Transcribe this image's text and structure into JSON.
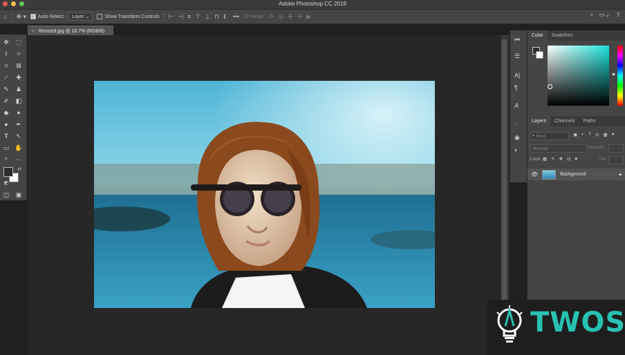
{
  "window": {
    "title": "Adobe Photoshop CC 2019"
  },
  "options_bar": {
    "auto_select_label": "Auto-Select:",
    "auto_select_checked": true,
    "layer_select_value": "Layer",
    "show_transform_label": "Show Transform Controls",
    "mode_3d_label": "3D Mode:"
  },
  "document": {
    "tab_title": "Resized.jpg @ 16.7% (RGB/8)"
  },
  "panels": {
    "color_tabs": [
      "Color",
      "Swatches"
    ],
    "layer_tabs": [
      "Layers",
      "Channels",
      "Paths"
    ],
    "filter_kind": "Kind",
    "blend_mode": "Normal",
    "opacity_label": "Opacity:",
    "lock_label": "Lock:",
    "fill_label": "Fill:",
    "layer_name": "Background"
  },
  "watermark": {
    "text": "TWOS"
  },
  "colors": {
    "accent": "#29c1b1",
    "ui_dark": "#272727",
    "ui_mid": "#454545"
  }
}
